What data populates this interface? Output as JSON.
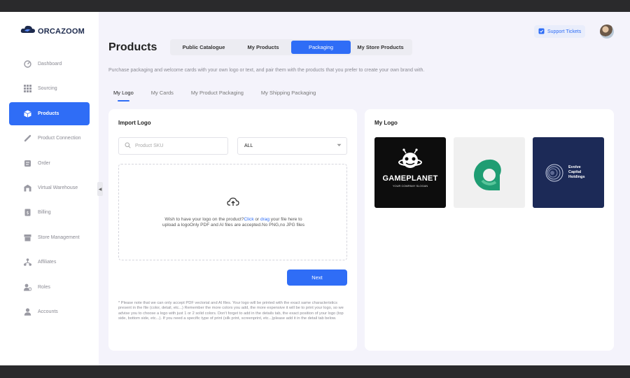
{
  "brand": {
    "name": "ORCAZOOM",
    "icon": "orca-cloud-logo"
  },
  "sidebar": {
    "items": [
      {
        "label": "Dashboard",
        "icon": "dashboard-icon",
        "active": false
      },
      {
        "label": "Sourcing",
        "icon": "grid-icon",
        "active": false
      },
      {
        "label": "Products",
        "icon": "box-icon",
        "active": true
      },
      {
        "label": "Product Connection",
        "icon": "link-icon",
        "active": false
      },
      {
        "label": "Order",
        "icon": "order-icon",
        "active": false
      },
      {
        "label": "Virtual Warehouse",
        "icon": "warehouse-icon",
        "active": false
      },
      {
        "label": "Billing",
        "icon": "billing-icon",
        "active": false
      },
      {
        "label": "Store Management",
        "icon": "store-icon",
        "active": false
      },
      {
        "label": "Affiliates",
        "icon": "affiliates-icon",
        "active": false
      },
      {
        "label": "Roles",
        "icon": "roles-icon",
        "active": false
      },
      {
        "label": "Accounts",
        "icon": "account-icon",
        "active": false
      }
    ]
  },
  "header": {
    "support_label": "Support Tickets",
    "title": "Products",
    "tabs": [
      {
        "label": "Public Catalogue",
        "active": false
      },
      {
        "label": "My Products",
        "active": false
      },
      {
        "label": "Packaging",
        "active": true
      },
      {
        "label": "My Store Products",
        "active": false
      }
    ],
    "subtitle": "Purchase packaging and welcome cards with your own logo or text, and pair them with the products that you prefer to create your own brand with."
  },
  "sub_tabs": [
    {
      "label": "My Logo",
      "active": true
    },
    {
      "label": "My Cards",
      "active": false
    },
    {
      "label": "My Product Packaging",
      "active": false
    },
    {
      "label": "My Shipping Packaging",
      "active": false
    }
  ],
  "import_card": {
    "title": "Import Logo",
    "search_placeholder": "Product SKU",
    "select_value": "ALL",
    "upload": {
      "text_before": "Wish to have your logo on the product?",
      "click": "Click",
      "or": " or ",
      "drag": "drag",
      "text_after": " your file here to upload a logoOnly PDF and AI files are accepted.No PNG,no JPG files"
    },
    "next_label": "Next",
    "note": "* Please note that we can only accept PDF vectorial and AI files. Your logo will be printed with the exact same characteristics present in the file (color, detail, etc...) Remember the more colors you add, the more expensive it will be to print your logo, so we advise you to choose a logo with just 1 or 2 solid colors. Don't forget to add in the details tab, the exact position of your logo (top side, bottom side, etc...). If you need a specific type of print (silk print, screenprint, etc...)please add it in the detail tab below."
  },
  "logo_card": {
    "title": "My Logo",
    "logos": [
      {
        "name": "gameplanet-logo",
        "text": "GAMEPLANET",
        "slogan": "YOUR COMPANY SLOGAN",
        "bg": "#0d0d0d"
      },
      {
        "name": "green-a-logo",
        "bg": "#f0f0f0",
        "accent": "#1f9d73"
      },
      {
        "name": "evolve-logo",
        "lines": [
          "Evolve",
          "Capital",
          "Holdings"
        ],
        "bg": "#1c2a57"
      }
    ]
  },
  "colors": {
    "accent": "#2f6df6",
    "background": "#f4f3fb"
  }
}
